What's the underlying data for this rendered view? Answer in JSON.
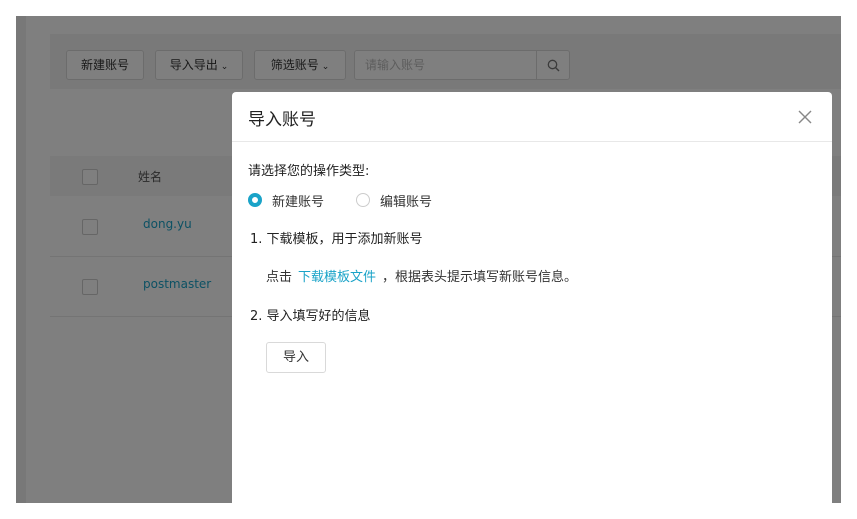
{
  "toolbar": {
    "new_account": "新建账号",
    "import_export": "导入导出",
    "filter_accounts": "筛选账号",
    "search_placeholder": "请输入账号"
  },
  "table": {
    "header_name": "姓名",
    "rows": [
      {
        "name": "dong.yu"
      },
      {
        "name": "postmaster"
      }
    ]
  },
  "modal": {
    "title": "导入账号",
    "prompt": "请选择您的操作类型:",
    "options": [
      {
        "label": "新建账号",
        "checked": true
      },
      {
        "label": "编辑账号",
        "checked": false
      }
    ],
    "step1": "1. 下载模板，用于添加新账号",
    "hint_prefix": "点击",
    "hint_link": "下载模板文件",
    "hint_suffix": "，根据表头提示填写新账号信息。",
    "step2": "2. 导入填写好的信息",
    "import_button": "导入"
  },
  "colors": {
    "accent": "#1aa3c8",
    "overlay": "rgba(0,0,0,0.5)"
  },
  "icons": {
    "search": "search-icon",
    "close": "close-icon",
    "chevron": "chevron-down-icon"
  }
}
